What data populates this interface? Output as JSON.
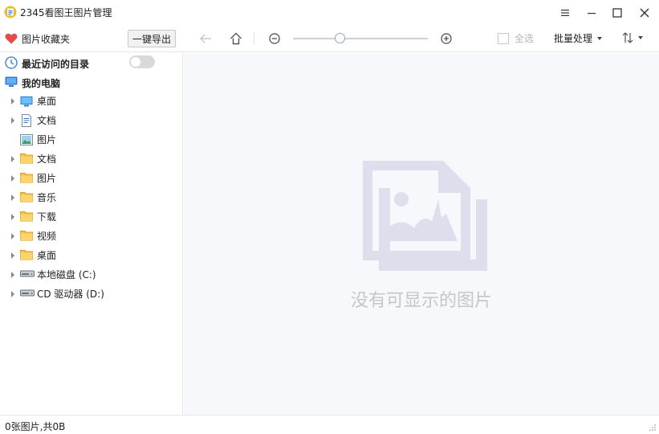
{
  "window": {
    "title": "2345看图王图片管理",
    "controls": [
      "menu-icon",
      "minimize-icon",
      "maximize-icon",
      "close-icon"
    ]
  },
  "toolbar": {
    "favorites_label": "图片收藏夹",
    "export_label": "一键导出",
    "zoom_level": 0.35,
    "select_all_label": "全选",
    "select_all_checked": false,
    "batch_label": "批量处理"
  },
  "sidebar": {
    "recent_label": "最近访问的目录",
    "recent_toggle_on": false,
    "my_computer_label": "我的电脑",
    "items": [
      {
        "label": "桌面",
        "icon": "desktop-icon",
        "expandable": true
      },
      {
        "label": "文档",
        "icon": "document-icon",
        "expandable": true
      },
      {
        "label": "图片",
        "icon": "picture-icon",
        "expandable": false
      },
      {
        "label": "文档",
        "icon": "folder-icon",
        "expandable": true
      },
      {
        "label": "图片",
        "icon": "folder-icon",
        "expandable": true
      },
      {
        "label": "音乐",
        "icon": "folder-icon",
        "expandable": true
      },
      {
        "label": "下载",
        "icon": "folder-icon",
        "expandable": true
      },
      {
        "label": "视频",
        "icon": "folder-icon",
        "expandable": true
      },
      {
        "label": "桌面",
        "icon": "folder-icon",
        "expandable": true
      },
      {
        "label": "本地磁盘 (C:)",
        "icon": "drive-icon",
        "expandable": true
      },
      {
        "label": "CD 驱动器 (D:)",
        "icon": "drive-icon",
        "expandable": true
      }
    ]
  },
  "main": {
    "empty_message": "没有可显示的图片"
  },
  "status": {
    "text": "0张图片,共0B"
  },
  "colors": {
    "accent": "#2a7bd1",
    "heart": "#e34a4a",
    "folder": "#f6c14f",
    "empty_illustration": "#dde0ec",
    "content_bg": "#f6f8fb"
  }
}
